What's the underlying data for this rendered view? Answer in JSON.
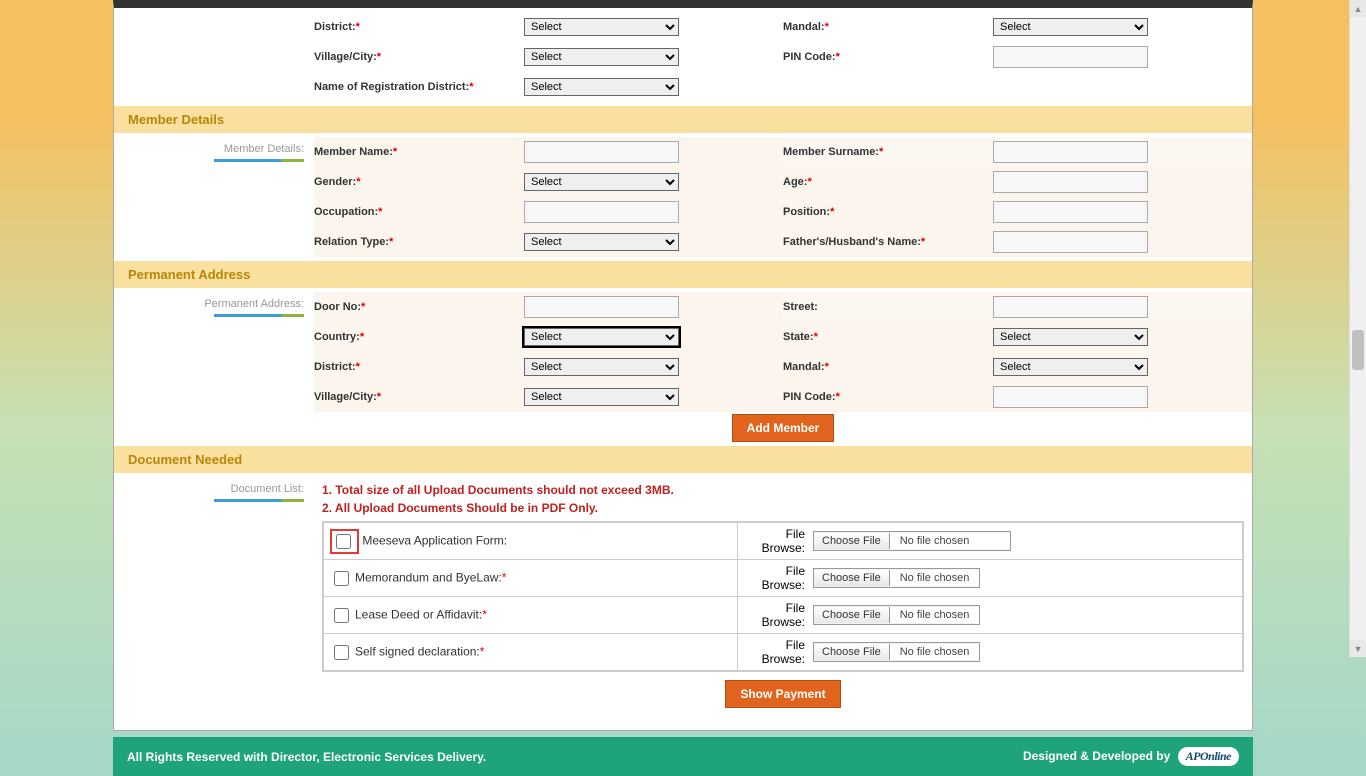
{
  "common": {
    "select_placeholder": "Select",
    "required_mark": "*"
  },
  "top_section": {
    "fields": {
      "district": "District:",
      "mandal": "Mandal:",
      "village": "Village/City:",
      "pin": "PIN Code:",
      "regdist": "Name of Registration District:"
    }
  },
  "member_section": {
    "header": "Member Details",
    "sidelabel": "Member Details:",
    "fields": {
      "name": "Member Name:",
      "surname": "Member Surname:",
      "gender": "Gender:",
      "age": "Age:",
      "occupation": "Occupation:",
      "position": "Position:",
      "relation": "Relation Type:",
      "fathhus": "Father's/Husband's Name:"
    }
  },
  "perm_section": {
    "header": "Permanent Address",
    "sidelabel": "Permanent Address:",
    "fields": {
      "door": "Door No:",
      "street": "Street:",
      "country": "Country:",
      "state": "State:",
      "district": "District:",
      "mandal": "Mandal:",
      "village": "Village/City:",
      "pin": "PIN Code:"
    },
    "add_member_btn": "Add Member"
  },
  "doc_section": {
    "header": "Document Needed",
    "sidelabel": "Document List:",
    "notes": [
      "1. Total size of all Upload Documents should not exceed 3MB.",
      "2. All Upload Documents Should be in PDF Only."
    ],
    "file_browse_label": "File Browse:",
    "choose_file": "Choose File",
    "no_file": "No file chosen",
    "rows": [
      {
        "label": "Meeseva Application Form:",
        "required": false,
        "highlight": true
      },
      {
        "label": "Memorandum and ByeLaw:",
        "required": true,
        "highlight": false
      },
      {
        "label": "Lease Deed or Affidavit:",
        "required": true,
        "highlight": false
      },
      {
        "label": "Self signed declaration:",
        "required": true,
        "highlight": false
      }
    ],
    "show_payment_btn": "Show Payment"
  },
  "footer": {
    "left": "All Rights Reserved with Director, Electronic Services Delivery.",
    "right": "Designed & Developed by",
    "brand": "APOnline"
  }
}
